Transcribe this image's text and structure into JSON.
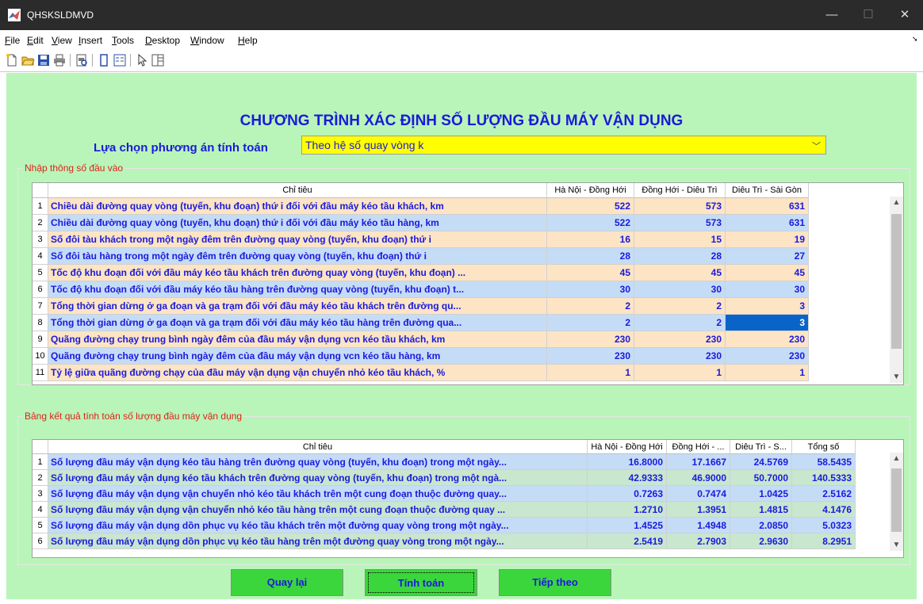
{
  "window": {
    "title": "QHSKSLDMVD"
  },
  "menu": [
    {
      "label": "File",
      "u": "F",
      "rest": "ile"
    },
    {
      "label": "Edit",
      "u": "E",
      "rest": "dit"
    },
    {
      "label": "View",
      "u": "V",
      "rest": "iew"
    },
    {
      "label": "Insert",
      "u": "I",
      "rest": "nsert"
    },
    {
      "label": "Tools",
      "u": "T",
      "rest": "ools"
    },
    {
      "label": "Desktop",
      "u": "D",
      "rest": "esktop"
    },
    {
      "label": "Window",
      "u": "W",
      "rest": "indow"
    },
    {
      "label": "Help",
      "u": "H",
      "rest": "elp"
    }
  ],
  "toolbar_icons": [
    "new-file-icon",
    "open-folder-icon",
    "save-icon",
    "print-icon",
    "print-preview-icon",
    "colorbar-icon",
    "legend-icon",
    "pointer-icon",
    "property-editor-icon"
  ],
  "main_title": "CHƯƠNG TRÌNH XÁC ĐỊNH SỐ LƯỢNG ĐẦU MÁY VẬN DỤNG",
  "option": {
    "label": "Lựa chọn phương án tính toán",
    "selected": "Theo hệ số quay vòng k"
  },
  "input_panel": {
    "title": "Nhập thông số đầu vào",
    "columns": [
      "Chỉ tiêu",
      "Hà Nội - Đồng Hới",
      "Đồng Hới - Diêu Trì",
      "Diêu Trì - Sài Gòn"
    ],
    "rows": [
      {
        "n": "1",
        "label": "Chiều dài đường quay vòng (tuyến, khu đoạn) thứ i đối với đầu máy kéo tầu khách, km",
        "v": [
          "522",
          "573",
          "631"
        ]
      },
      {
        "n": "2",
        "label": "Chiều dài đường quay vòng (tuyến, khu đoạn) thứ i đối với đầu máy kéo tầu hàng, km",
        "v": [
          "522",
          "573",
          "631"
        ]
      },
      {
        "n": "3",
        "label": "Số đôi tàu khách trong một ngày đêm trên đường quay vòng (tuyến, khu đoạn) thứ i",
        "v": [
          "16",
          "15",
          "19"
        ]
      },
      {
        "n": "4",
        "label": "Số đôi tàu hàng trong một ngày đêm trên đường quay vòng (tuyến, khu đoạn) thứ i",
        "v": [
          "28",
          "28",
          "27"
        ]
      },
      {
        "n": "5",
        "label": "Tốc độ khu đoạn đối với đầu máy kéo tầu khách trên đường quay vòng (tuyến, khu đoạn) ...",
        "v": [
          "45",
          "45",
          "45"
        ]
      },
      {
        "n": "6",
        "label": "Tốc độ khu đoạn đối với đầu máy kéo tầu hàng trên đường quay vòng (tuyến, khu đoạn) t...",
        "v": [
          "30",
          "30",
          "30"
        ]
      },
      {
        "n": "7",
        "label": "Tổng thời gian dừng ở ga đoạn và ga trạm đối với đầu máy kéo tầu khách trên đường qu...",
        "v": [
          "2",
          "2",
          "3"
        ]
      },
      {
        "n": "8",
        "label": "Tổng thời gian dừng ở ga đoạn và ga trạm đối với đầu máy kéo tầu hàng trên đường qua...",
        "v": [
          "2",
          "2",
          "3"
        ]
      },
      {
        "n": "9",
        "label": "Quãng đường chạy trung bình ngày đêm của đầu máy vận dụng vcn kéo tầu khách, km",
        "v": [
          "230",
          "230",
          "230"
        ]
      },
      {
        "n": "10",
        "label": "Quãng đường chạy trung bình ngày đêm của đầu máy vận dụng vcn kéo tầu hàng, km",
        "v": [
          "230",
          "230",
          "230"
        ]
      },
      {
        "n": "11",
        "label": "Tỷ lệ giữa quãng đường chạy của đầu máy vận dụng vận chuyển nhỏ kéo tầu khách, %",
        "v": [
          "1",
          "1",
          "1"
        ]
      }
    ]
  },
  "result_panel": {
    "title": "Bảng kết quả tính toán số lượng đầu máy vận dụng",
    "columns": [
      "Chỉ tiêu",
      "Hà Nội - Đồng Hới",
      "Đồng Hới - ...",
      "Diêu Trì - S...",
      "Tổng số"
    ],
    "rows": [
      {
        "n": "1",
        "label": "Số lượng đầu máy vận dụng kéo tầu hàng trên đường quay vòng (tuyến, khu đoạn) trong một ngày...",
        "v": [
          "16.8000",
          "17.1667",
          "24.5769",
          "58.5435"
        ]
      },
      {
        "n": "2",
        "label": "Số lượng đầu máy vận dụng kéo tầu khách trên đường quay vòng (tuyến, khu đoạn) trong một ngà...",
        "v": [
          "42.9333",
          "46.9000",
          "50.7000",
          "140.5333"
        ]
      },
      {
        "n": "3",
        "label": "Số lượng đầu máy vận dụng vận chuyển nhỏ kéo tầu khách trên một cung đoạn thuộc đường quay...",
        "v": [
          "0.7263",
          "0.7474",
          "1.0425",
          "2.5162"
        ]
      },
      {
        "n": "4",
        "label": "Số lượng đầu máy vận dụng vận chuyển nhỏ kéo tầu hàng trên một cung đoạn thuộc đường quay ...",
        "v": [
          "1.2710",
          "1.3951",
          "1.4815",
          "4.1476"
        ]
      },
      {
        "n": "5",
        "label": "Số lượng đầu máy vận dụng dồn phục vụ kéo tầu khách trên một đường quay vòng trong một ngày...",
        "v": [
          "1.4525",
          "1.4948",
          "2.0850",
          "5.0323"
        ]
      },
      {
        "n": "6",
        "label": "Số lượng đầu máy vận dụng dồn phục vụ kéo tầu hàng trên một  đường quay vòng trong một ngày...",
        "v": [
          "2.5419",
          "2.7903",
          "2.9630",
          "8.2951"
        ]
      }
    ]
  },
  "buttons": {
    "back": "Quay lại",
    "compute": "Tính toán",
    "next": "Tiếp theo"
  },
  "colors": {
    "figure_bg": "#b9f5b9",
    "title_blue": "#1a1adc",
    "row_orange": "#fce4c4",
    "row_blue": "#c5dcf6",
    "row_green": "#c9e6cf",
    "button_green": "#3bd63b",
    "select_yellow": "#ffff00",
    "selection": "#0a64c8"
  }
}
